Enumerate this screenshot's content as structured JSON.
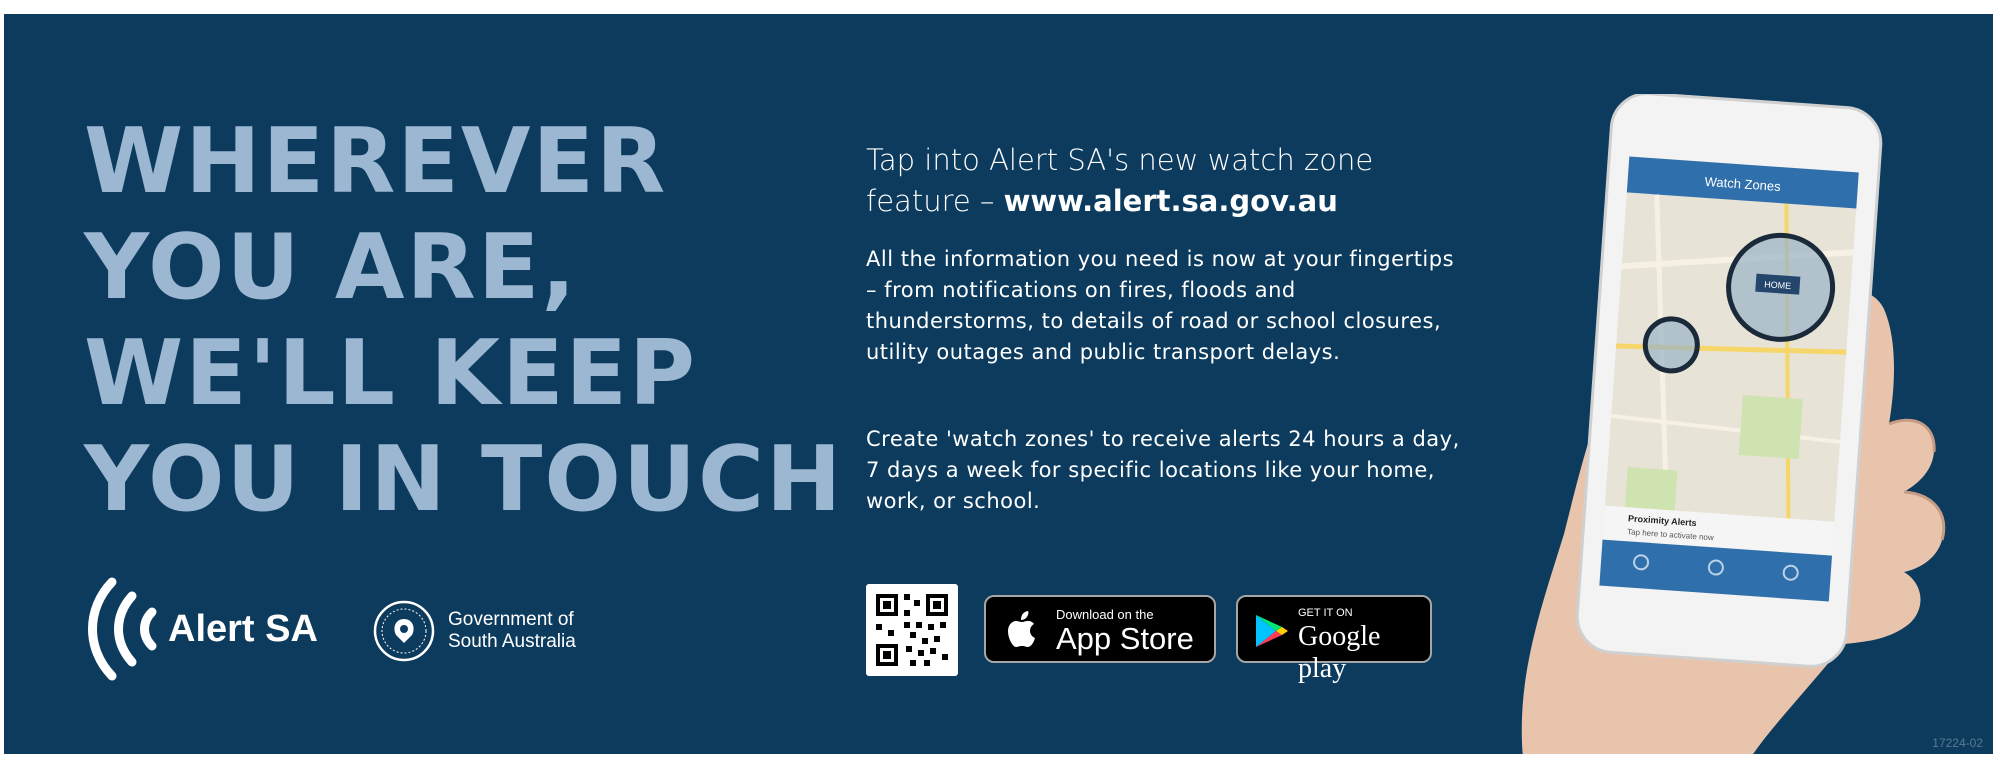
{
  "headline": {
    "lines": [
      "WHEREVER",
      "YOU ARE,",
      "WE'LL KEEP",
      "YOU IN TOUCH"
    ]
  },
  "logos": {
    "alert_sa": "Alert SA",
    "government_line1": "Government of",
    "government_line2": "South Australia"
  },
  "intro": {
    "text": "Tap into Alert SA's new watch zone feature – ",
    "url": "www.alert.sa.gov.au"
  },
  "body": {
    "paragraph1": "All the information you need is now at your fingertips – from notifications on fires, floods and thunderstorms, to details of road or school closures, utility outages and public transport delays.",
    "paragraph2": "Create 'watch zones' to receive alerts 24 hours a day, 7 days a week for specific locations like your home, work, or school."
  },
  "badges": {
    "appstore_small": "Download on the",
    "appstore_big": "App Store",
    "gplay_small": "GET IT ON",
    "gplay_big": "Google play"
  },
  "phone": {
    "screen_title": "Watch Zones",
    "zone_label": "HOME",
    "alert_title": "Proximity Alerts",
    "alert_sub": "Tap here to activate now"
  },
  "code": "17224-02",
  "colors": {
    "background": "#0c3b5e",
    "headline": "#9bb7d1"
  }
}
